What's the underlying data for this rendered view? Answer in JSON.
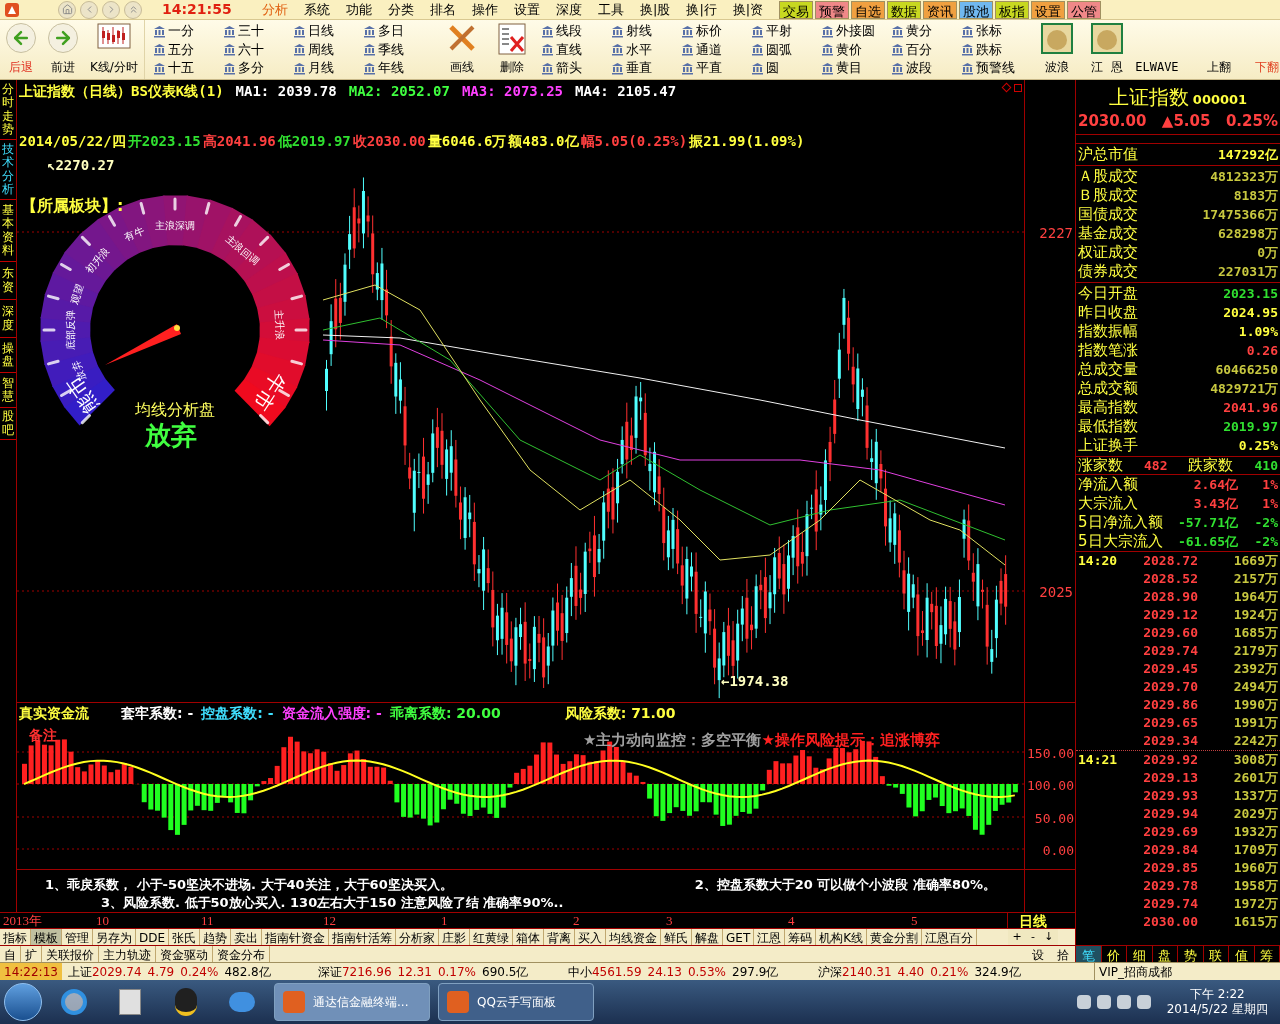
{
  "menubar": {
    "time": "14:21:55",
    "menus": [
      {
        "label": "分析",
        "selected": true
      },
      {
        "label": "系统",
        "selected": false
      },
      {
        "label": "功能",
        "selected": false
      },
      {
        "label": "分类",
        "selected": false
      },
      {
        "label": "排名",
        "selected": false
      },
      {
        "label": "操作",
        "selected": false
      },
      {
        "label": "设置",
        "selected": false
      },
      {
        "label": "深度",
        "selected": false
      },
      {
        "label": "工具",
        "selected": false
      },
      {
        "label": "换|股",
        "selected": false
      },
      {
        "label": "换|行",
        "selected": false
      },
      {
        "label": "换|资",
        "selected": false
      }
    ],
    "quick_buttons": [
      {
        "label": "交易",
        "color": "#c8d820"
      },
      {
        "label": "预警",
        "color": "#f08888"
      },
      {
        "label": "自选",
        "color": "#f0a040"
      },
      {
        "label": "数据",
        "color": "#c8d820"
      },
      {
        "label": "资讯",
        "color": "#f0a040"
      },
      {
        "label": "股池",
        "color": "#70b8f0"
      },
      {
        "label": "板指",
        "color": "#c8d820"
      },
      {
        "label": "设置",
        "color": "#f0a040"
      },
      {
        "label": "公管",
        "color": "#f08888"
      }
    ]
  },
  "toolbar": {
    "nav": [
      {
        "label": "后退",
        "kind": "back",
        "highlighted": true
      },
      {
        "label": "前进",
        "kind": "forward",
        "highlighted": false
      },
      {
        "label": "K线/分时",
        "kind": "chart",
        "highlighted": false
      }
    ],
    "period_columns": [
      [
        "一分",
        "五分",
        "十五"
      ],
      [
        "三十",
        "六十",
        "多分"
      ],
      [
        "日线",
        "周线",
        "月线"
      ],
      [
        "多日",
        "季线",
        "年线"
      ]
    ],
    "draw_buttons": [
      {
        "label": "画线",
        "kind": "pencil"
      },
      {
        "label": "删除",
        "kind": "delete"
      }
    ],
    "shape_columns": [
      [
        "线段",
        "直线",
        "箭头"
      ],
      [
        "射线",
        "水平",
        "垂直"
      ],
      [
        "标价",
        "通道",
        "平直"
      ],
      [
        "平射",
        "圆弧",
        "圆"
      ],
      [
        "外接圆",
        "黄价",
        "黄目"
      ],
      [
        "黄分",
        "百分",
        "波段"
      ],
      [
        "张标",
        "跌标",
        "预警线"
      ]
    ],
    "wave_buttons": [
      {
        "label": "波浪",
        "kind": "avatar"
      },
      {
        "label": "江 恩",
        "kind": "avatar"
      },
      {
        "label": "ELWAVE",
        "kind": "text"
      }
    ],
    "page_buttons": [
      {
        "label": "上翻",
        "highlighted": false
      },
      {
        "label": "下翻",
        "highlighted": true
      }
    ]
  },
  "side_tabs": [
    {
      "label": "分时走势",
      "selected": false
    },
    {
      "label": "技术分析",
      "selected": true
    },
    {
      "label": "基本资料",
      "selected": false
    },
    {
      "label": "东资",
      "selected": false
    },
    {
      "label": "深度",
      "selected": false
    },
    {
      "label": "操盘",
      "selected": false
    },
    {
      "label": "智慧",
      "selected": false
    },
    {
      "label": "股吧",
      "selected": false
    }
  ],
  "chart": {
    "title": "上证指数（日线）BS仪表K线(1)",
    "ma": [
      {
        "label": "MA1: 2039.78",
        "color": "#ffffff"
      },
      {
        "label": "MA2: 2052.07",
        "color": "#40ff40"
      },
      {
        "label": "MA3: 2073.25",
        "color": "#ff40ff"
      },
      {
        "label": "MA4: 2105.47",
        "color": "#ffffff"
      }
    ],
    "quote": [
      {
        "text": "2014/05/22/四",
        "color": "#ffff40"
      },
      {
        "text": "开2023.15",
        "color": "#30e030"
      },
      {
        "text": "高2041.96",
        "color": "#ff4040"
      },
      {
        "text": "低2019.97",
        "color": "#30e030"
      },
      {
        "text": "收2030.00",
        "color": "#ff4040"
      },
      {
        "text": "量6046.6万",
        "color": "#ffff40"
      },
      {
        "text": "额483.0亿",
        "color": "#ffff40"
      },
      {
        "text": "幅5.05(0.25%)",
        "color": "#ff4040"
      },
      {
        "text": "振21.99(1.09%)",
        "color": "#ffff40"
      }
    ],
    "high_mark": "↖2270.27",
    "low_mark": "←1974.38",
    "sector": "【所属板块】:",
    "price_ticks": [
      "2227",
      "2025"
    ],
    "gauge": {
      "labels": [
        {
          "text": "熊市",
          "kind": "large"
        },
        {
          "text": "放弃",
          "kind": "small"
        },
        {
          "text": "底部反弹",
          "kind": "small"
        },
        {
          "text": "观望",
          "kind": "small"
        },
        {
          "text": "初升浪",
          "kind": "small"
        },
        {
          "text": "有牛",
          "kind": "small"
        },
        {
          "text": "主浪深调",
          "kind": "small"
        },
        {
          "text": "主浪回调",
          "kind": "small"
        },
        {
          "text": "主升浪",
          "kind": "small"
        },
        {
          "text": "牛市",
          "kind": "large"
        }
      ],
      "caption": "均线分析盘",
      "verdict": "放弃"
    }
  },
  "indicator": {
    "title": "真实资金流",
    "params": [
      {
        "text": "套牢系数: -",
        "color": "#ffffff"
      },
      {
        "text": "控盘系数: -",
        "color": "#40e0ff"
      },
      {
        "text": "资金流入强度: -",
        "color": "#ff40ff"
      },
      {
        "text": "乖离系数: 20.00",
        "color": "#40ff40"
      },
      {
        "text": "风险系数: 71.00",
        "color": "#ffff40"
      }
    ],
    "note": "备注",
    "monitor": "★主力动向监控：多空平衡",
    "risk": "★操作风险提示：追涨博弈",
    "ticks": [
      "150.00",
      "100.00",
      "50.00",
      "0.00"
    ]
  },
  "notes": [
    "1、乖戾系数，  小于-50坚决不进场. 大于40关注，大于60坚决买入。",
    "2、控盘系数大于20 可以做个小波段   准确率80%。",
    "3、风险系数. 低于50放心买入. 130左右大于150 注意风险了结   准确率90%.."
  ],
  "date_axis": {
    "labels": [
      "2013年",
      "10",
      "11",
      "12",
      "1",
      "2",
      "3",
      "4",
      "5"
    ],
    "period": "日线"
  },
  "template_tabs": [
    {
      "label": "指标",
      "selected": false
    },
    {
      "label": "模板",
      "selected": true
    },
    {
      "label": "管理",
      "selected": false
    },
    {
      "label": "另存为",
      "selected": false
    },
    {
      "label": "DDE",
      "selected": false
    },
    {
      "label": "张氏",
      "selected": false
    },
    {
      "label": "趋势",
      "selected": false
    },
    {
      "label": "卖出",
      "selected": false
    },
    {
      "label": "指南针资金",
      "selected": false
    },
    {
      "label": "指南针活筹",
      "selected": false
    },
    {
      "label": "分析家",
      "selected": false
    },
    {
      "label": "庄影",
      "selected": false
    },
    {
      "label": "红黄绿",
      "selected": false
    },
    {
      "label": "箱体",
      "selected": false
    },
    {
      "label": "背离",
      "selected": false
    },
    {
      "label": "买入",
      "selected": false
    },
    {
      "label": "均线资金",
      "selected": false
    },
    {
      "label": "鲜氏",
      "selected": false
    },
    {
      "label": "解盘",
      "selected": false
    },
    {
      "label": "GET",
      "selected": false
    },
    {
      "label": "江恩",
      "selected": false
    },
    {
      "label": "筹码",
      "selected": false
    },
    {
      "label": "机构K线",
      "selected": false
    },
    {
      "label": "黄金分割",
      "selected": false
    },
    {
      "label": "江恩百分",
      "selected": false
    }
  ],
  "template_controls": [
    "+",
    "-",
    "↓"
  ],
  "lower_tabs": [
    {
      "label": "自",
      "selected": false
    },
    {
      "label": "扩",
      "selected": false
    },
    {
      "label": "关联报价",
      "selected": false
    },
    {
      "label": "主力轨迹",
      "selected": false
    },
    {
      "label": "资金驱动",
      "selected": false
    },
    {
      "label": "资金分布",
      "selected": false
    }
  ],
  "lower_controls": [
    "设",
    "拾"
  ],
  "quote_panel": {
    "name": "上证指数",
    "code": "000001",
    "price": "2030.00",
    "change": "▲5.05",
    "pct": "0.25%",
    "groups": [
      [
        {
          "label": "沪总市值",
          "value": "147292亿",
          "color": "#ffff40"
        }
      ],
      [
        {
          "label": "Ａ股成交",
          "value": "4812323万",
          "color": "#c8c840"
        },
        {
          "label": "Ｂ股成交",
          "value": "8183万",
          "color": "#c8c840"
        },
        {
          "label": "国债成交",
          "value": "17475366万",
          "color": "#c8c840"
        },
        {
          "label": "基金成交",
          "value": "628298万",
          "color": "#c8c840"
        },
        {
          "label": "权证成交",
          "value": "0万",
          "color": "#c8c840"
        },
        {
          "label": "债券成交",
          "value": "227031万",
          "color": "#c8c840"
        }
      ],
      [
        {
          "label": "今日开盘",
          "value": "2023.15",
          "color": "#30e030"
        },
        {
          "label": "昨日收盘",
          "value": "2024.95",
          "color": "#ffff40"
        },
        {
          "label": "指数振幅",
          "value": "1.09%",
          "color": "#ffff40"
        },
        {
          "label": "指数笔涨",
          "value": "0.26",
          "color": "#ff4040"
        },
        {
          "label": "总成交量",
          "value": "60466250",
          "color": "#c8c840"
        },
        {
          "label": "总成交额",
          "value": "4829721万",
          "color": "#c8c840"
        },
        {
          "label": "最高指数",
          "value": "2041.96",
          "color": "#ff4040"
        },
        {
          "label": "最低指数",
          "value": "2019.97",
          "color": "#30e030"
        },
        {
          "label": "上证换手",
          "value": "0.25%",
          "color": "#ffff40"
        }
      ]
    ],
    "breadth": {
      "up_label": "涨家数",
      "up": "482",
      "down_label": "跌家数",
      "down": "410"
    },
    "flows": [
      {
        "label": "净流入额",
        "value": "2.64亿",
        "pct": "1%",
        "color": "#ff4040"
      },
      {
        "label": "大宗流入",
        "value": "3.43亿",
        "pct": "1%",
        "color": "#ff4040"
      },
      {
        "label": "5日净流入额",
        "value": "-57.71亿",
        "pct": "-2%",
        "color": "#30e030"
      },
      {
        "label": "5日大宗流入",
        "value": "-61.65亿",
        "pct": "-2%",
        "color": "#30e030"
      }
    ],
    "ticks": [
      {
        "time": "14:20",
        "rows": [
          [
            "2028.72",
            "1669万"
          ],
          [
            "2028.52",
            "2157万"
          ],
          [
            "2028.90",
            "1964万"
          ],
          [
            "2029.12",
            "1924万"
          ],
          [
            "2029.60",
            "1685万"
          ],
          [
            "2029.74",
            "2179万"
          ],
          [
            "2029.45",
            "2392万"
          ],
          [
            "2029.70",
            "2494万"
          ],
          [
            "2029.86",
            "1990万"
          ],
          [
            "2029.65",
            "1991万"
          ],
          [
            "2029.34",
            "2242万"
          ]
        ]
      },
      {
        "time": "14:21",
        "rows": [
          [
            "2029.92",
            "3008万"
          ],
          [
            "2029.13",
            "2601万"
          ],
          [
            "2029.93",
            "1337万"
          ],
          [
            "2029.94",
            "2029万"
          ],
          [
            "2029.69",
            "1932万"
          ],
          [
            "2029.84",
            "1709万"
          ],
          [
            "2029.85",
            "1960万"
          ],
          [
            "2029.78",
            "1958万"
          ],
          [
            "2029.74",
            "1972万"
          ],
          [
            "2030.00",
            "1615万"
          ]
        ]
      }
    ],
    "tabs": [
      {
        "label": "笔",
        "selected": true
      },
      {
        "label": "价",
        "selected": false
      },
      {
        "label": "细",
        "selected": false
      },
      {
        "label": "盘",
        "selected": false
      },
      {
        "label": "势",
        "selected": false
      },
      {
        "label": "联",
        "selected": false
      },
      {
        "label": "值",
        "selected": false
      },
      {
        "label": "筹",
        "selected": false
      }
    ]
  },
  "status_bar": {
    "time": "14:22:13",
    "indexes": [
      {
        "name": "上证",
        "value": "2029.74",
        "change": "4.79",
        "pct": "0.24%",
        "amount": "482.8亿"
      },
      {
        "name": "深证",
        "value": "7216.96",
        "change": "12.31",
        "pct": "0.17%",
        "amount": "690.5亿"
      },
      {
        "name": "中小",
        "value": "4561.59",
        "change": "24.13",
        "pct": "0.53%",
        "amount": "297.9亿"
      },
      {
        "name": "沪深",
        "value": "2140.31",
        "change": "4.40",
        "pct": "0.21%",
        "amount": "324.9亿"
      }
    ],
    "account": "VIP_招商成都"
  },
  "taskbar": {
    "windows": [
      {
        "label": "通达信金融终端...",
        "selected": true
      },
      {
        "label": "QQ云手写面板",
        "selected": false
      }
    ],
    "time": "下午 2:22",
    "date": "2014/5/22 星期四"
  }
}
